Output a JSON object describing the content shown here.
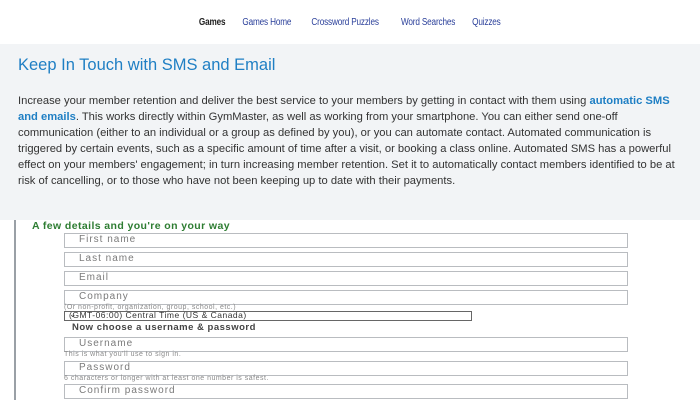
{
  "nav": {
    "items": [
      "Games",
      "Games Home",
      "Crossword Puzzles",
      "Word Searches",
      "Quizzes"
    ],
    "active_index": 0
  },
  "panel": {
    "title": "Keep In Touch with SMS and Email",
    "text_before_link": "Increase your member retention and deliver the best service to your members by getting in contact with them using ",
    "link_text": "automatic SMS and emails",
    "text_after_link": ". This works directly within GymMaster, as well as working from your smartphone. You can either send one-off communication (either to an individual or a group as defined by you), or you can automate contact. Automated communication is triggered by certain events, such as a specific amount of time after a visit, or booking a class online. Automated SMS has a powerful effect on your members' engagement; in turn increasing member retention. Set it to automatically contact members identified to be at risk of cancelling, or to those who have not been keeping up to date with their payments."
  },
  "form": {
    "heading": "A few details and you're on your way",
    "first_name_placeholder": "First name",
    "last_name_placeholder": "Last name",
    "email_placeholder": "Email",
    "company_placeholder": "Company",
    "company_hint": "(Or non-profit, organization, group, school, etc.)",
    "timezone_value": "(GMT-06:00) Central Time (US & Canada)",
    "credentials_heading": "Now choose a username & password",
    "username_placeholder": "Username",
    "username_hint": "This is what you'll use to sign in.",
    "password_placeholder": "Password",
    "password_hint": "6 characters or longer with at least one number is safest.",
    "confirm_password_placeholder": "Confirm password"
  }
}
